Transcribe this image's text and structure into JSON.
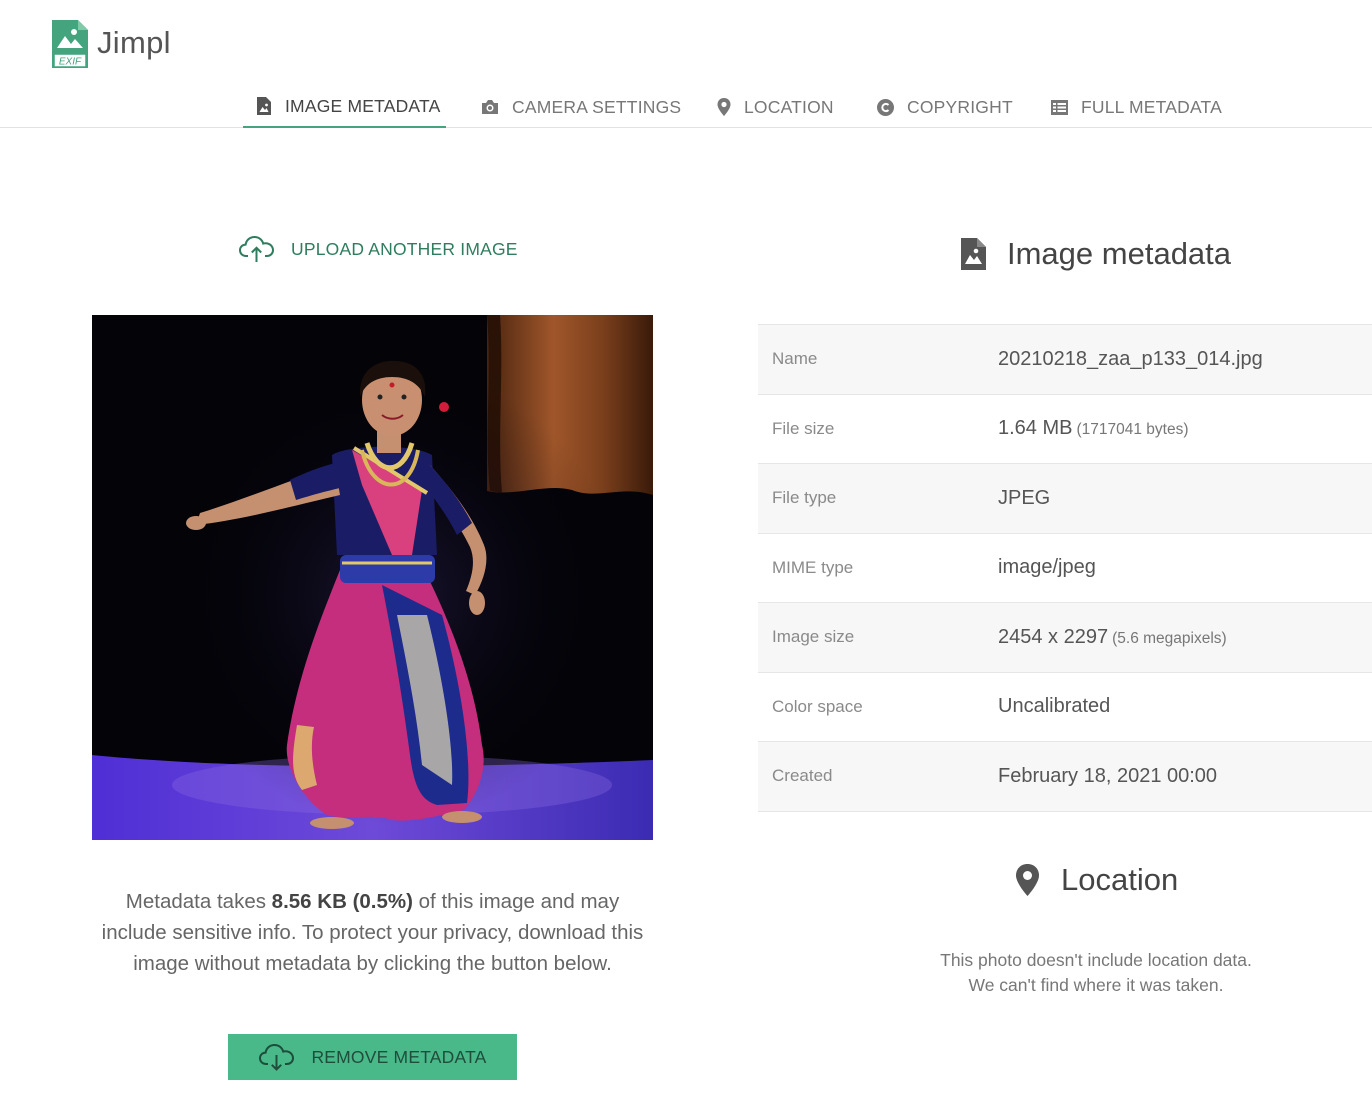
{
  "app": {
    "name": "Jimpl",
    "logo_badge": "EXIF",
    "accent": "#43a47e"
  },
  "nav": {
    "tabs": [
      {
        "label": "IMAGE METADATA",
        "icon": "file-image-icon",
        "active": true
      },
      {
        "label": "CAMERA SETTINGS",
        "icon": "camera-icon",
        "active": false
      },
      {
        "label": "LOCATION",
        "icon": "map-pin-icon",
        "active": false
      },
      {
        "label": "COPYRIGHT",
        "icon": "copyright-icon",
        "active": false
      },
      {
        "label": "FULL METADATA",
        "icon": "list-icon",
        "active": false
      }
    ]
  },
  "left": {
    "upload_label": "UPLOAD ANOTHER IMAGE",
    "note_prefix": "Metadata takes ",
    "note_bold": "8.56 KB (0.5%)",
    "note_suffix": " of this image and may include sensitive info. To protect your privacy, download this image without metadata by clicking the button below.",
    "remove_label": "REMOVE METADATA",
    "remove_color": "#49b98a"
  },
  "metadata": {
    "title": "Image metadata",
    "rows": [
      {
        "label": "Name",
        "value": "20210218_zaa_p133_014.jpg",
        "sub": ""
      },
      {
        "label": "File size",
        "value": "1.64 MB",
        "sub": "(1717041 bytes)"
      },
      {
        "label": "File type",
        "value": "JPEG",
        "sub": ""
      },
      {
        "label": "MIME type",
        "value": "image/jpeg",
        "sub": ""
      },
      {
        "label": "Image size",
        "value": "2454 x 2297",
        "sub": "(5.6 megapixels)"
      },
      {
        "label": "Color space",
        "value": "Uncalibrated",
        "sub": ""
      },
      {
        "label": "Created",
        "value": "February 18, 2021 00:00",
        "sub": ""
      }
    ]
  },
  "location": {
    "title": "Location",
    "line1": "This photo doesn't include location data.",
    "line2": "We can't find where it was taken."
  }
}
